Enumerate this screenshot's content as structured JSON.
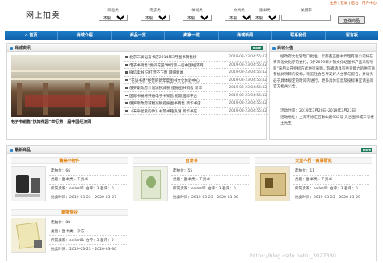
{
  "header": {
    "logo": "网上拍卖",
    "top_links": "注册 | 登录 | 后台 | 用户中心",
    "filters": [
      {
        "label": "商品类",
        "value": "不限"
      },
      {
        "label": "电子类",
        "value": "不限"
      },
      {
        "label": "休闲类",
        "value": "不限"
      },
      {
        "label": "文具类",
        "value": "不限"
      },
      {
        "label": "图书类",
        "value": "不限"
      }
    ],
    "keyword_label": "关键字",
    "keyword_value": "",
    "search_button": "查找商品"
  },
  "nav": [
    "首页",
    "商城介绍",
    "商品一览",
    "卖家一览",
    "商城新闻",
    "联系我们",
    "留言板"
  ],
  "news": {
    "title": "商城资讯",
    "more": "more",
    "photo_caption": "电子书销售\"悦知花园\"举行第十届中国经济网",
    "items": [
      {
        "title": "北京三联韬奋书店2014年3月图书销售榜",
        "date": "2019-03-23 04:56:42"
      },
      {
        "title": "电子书销售\"悦知花园\"举行第十届中国经济网",
        "date": "2019-03-23 04:56:42"
      },
      {
        "title": "微信卖书 只打营不下而 网赚新闻",
        "date": "2019-03-23 04:56:42"
      },
      {
        "title": "\"花语书香\"经营的新年度图书文化体验中心",
        "date": "2019-03-23 04:56:42"
      },
      {
        "title": "俄罗斯政府计划减税减税 提振图书销售 新华",
        "date": "2019-03-23 04:56:42"
      },
      {
        "title": "国际书展将开通电子书销售 搭建国际平台",
        "date": "2019-03-23 04:56:42"
      },
      {
        "title": "俄罗斯政府减税减税提振图书销售 新华书店",
        "date": "2019-03-23 04:56:42"
      },
      {
        "title": "《未命星爱的你》书荒书籍热潮 新华书店",
        "date": "2019-03-23 04:56:42"
      }
    ]
  },
  "notice": {
    "title": "商城公告",
    "body": "经政府文化管理门批准，云南鑫正图书代理有限公司将在青海省文化厅的委托，对\"2019年乡镇文化站图书产品采购项目\"采用公开招标方式进行采购，现邀请具有供货能力的供应商参加此项目的投标，欢迎社会各界友好人士参与报名，并请务必于具体规定的时间内进行，更多具体信息及投标事宜请查阅官方相关公告。",
    "time_label": "活动时间：",
    "time_value": "2019年3月20日-2019年3月23日",
    "address_label": "活动地址：",
    "address_value": "上海市徐汇区衡山路932号 光谷图书城三号楼 王先生"
  },
  "products": {
    "title": "最新商品",
    "more": "more",
    "items": [
      {
        "name": "精美小物件",
        "start_price": "起拍价：66",
        "category": "类别：图书类 - 工具书",
        "seller": "所属卖家：seller01 拍评：3 差评：0",
        "time": "拍卖时间：2019-03-23 - 2020-03-27"
      },
      {
        "name": "自宠书",
        "start_price": "起拍价：55",
        "category": "类别：图书类 - 工具书",
        "seller": "所属卖家：seller01 拍评：3 差评：0",
        "time": "拍卖时间：2019-03-23 - 2020-03-28"
      },
      {
        "name": "天堂不朽 · 叙事研究",
        "start_price": "起拍价：11",
        "category": "类别：图书类 - 工具书",
        "seller": "所属卖家：seller01 拍评：3 差评：0",
        "time": "拍卖时间：2019-03-23 - 2020-03-29"
      },
      {
        "name": "素描专业",
        "start_price": "起拍价：99",
        "category": "类别：图书类 - 杂志",
        "seller": "所属卖家：seller01 拍评：3 差评：0",
        "time": "拍卖时间：2019-03-23 - 2020-03-30"
      }
    ]
  },
  "watermark": "https://blog.csdn.net/u_3927380"
}
